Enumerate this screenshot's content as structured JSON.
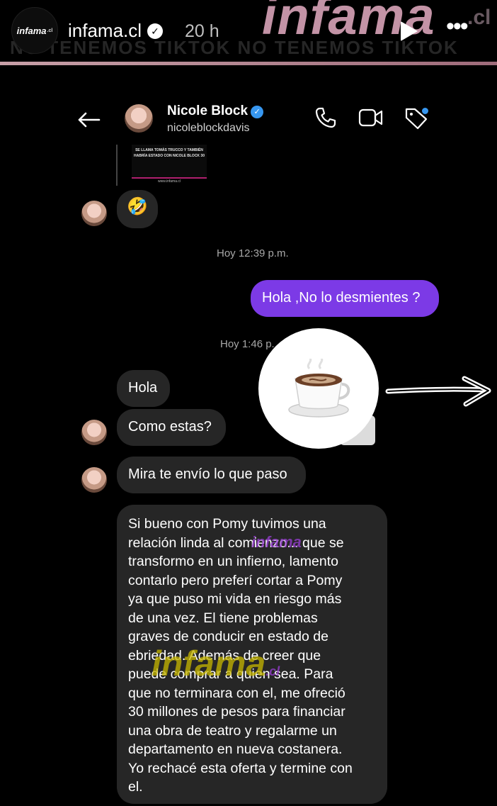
{
  "story": {
    "brand_background": "infama",
    "brand_background_suffix": ".cl",
    "marquee": "NO TENEMOS TIKTOK   NO TENEMOS TIKTOK",
    "avatar_logo": "infama",
    "avatar_logo_suffix": ".cl",
    "username": "infama.cl",
    "time": "20 h",
    "progress_bar_fill": 1.0,
    "icons": [
      "verified-badge-icon",
      "play-icon",
      "more-options-icon"
    ]
  },
  "chat": {
    "contact_name": "Nicole Block",
    "contact_handle": "nicoleblockdavis",
    "icons": [
      "back-arrow-icon",
      "phone-icon",
      "video-icon",
      "tag-icon"
    ],
    "accent_colors": {
      "outgoing_bubble": "#7c3ae6",
      "incoming_bubble": "#262626",
      "verified": "#3797f0"
    }
  },
  "shared_post": {
    "caption": "SE LLAMA TOMÁS TRUCCO Y TAMBIÉN HABRÍA ESTADO CON NICOLE BLOCK 30",
    "site": "www.infama.cl"
  },
  "messages": {
    "reaction_emoji": "🤣",
    "timestamp_1": "Hoy 12:39 p.m.",
    "outgoing_1": "Hola ,No lo desmientes ?",
    "timestamp_2": "Hoy 1:46 p.",
    "incoming_1": "Hola",
    "incoming_2": "Como estas?",
    "incoming_3": "Mira te envío lo que paso",
    "incoming_long": [
      "Si bueno con Pomy tuvimos una",
      "relación linda al comienzo... que se",
      "transformo en un infierno, lamento",
      "contarlo pero preferí cortar a Pomy",
      "ya que  puso mi vida en riesgo más",
      "de una vez. El tiene problemas",
      "graves de conducir en estado de",
      "ebriedad. Además de creer que",
      "puede comprar a quien sea. Para",
      "que no terminara con el, me ofreció",
      "30 millones de pesos para financiar",
      "una obra de teatro y regalarme un",
      "departamento en nueva costanera.",
      "Yo rechacé esta oferta y termine con",
      "el."
    ]
  },
  "overlays": {
    "sticker_emoji": "☕",
    "watermark": "infama",
    "watermark_suffix": ".cl"
  }
}
